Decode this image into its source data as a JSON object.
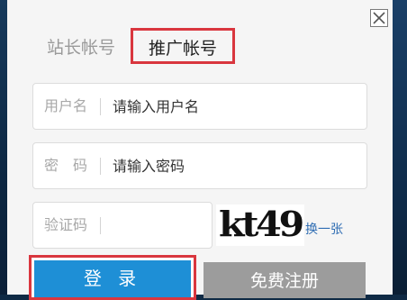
{
  "dialog": {
    "tabs": [
      {
        "label": "站长帐号",
        "active": false
      },
      {
        "label": "推广帐号",
        "active": true
      }
    ],
    "fields": {
      "username": {
        "label": "用户名",
        "placeholder": "请输入用户名",
        "value": ""
      },
      "password": {
        "label": "密　码",
        "placeholder": "请输入密码",
        "value": ""
      },
      "captcha": {
        "label": "验证码",
        "placeholder": "",
        "value": ""
      }
    },
    "captcha_image_text": "kt49",
    "refresh_link": "换一张",
    "login_button": "登 录",
    "register_button": "免费注册",
    "close_icon": "close-icon",
    "colors": {
      "highlight": "#d9363e",
      "primary": "#1e8fd6",
      "secondary": "#9c9c9c",
      "link": "#2f6db3"
    }
  }
}
